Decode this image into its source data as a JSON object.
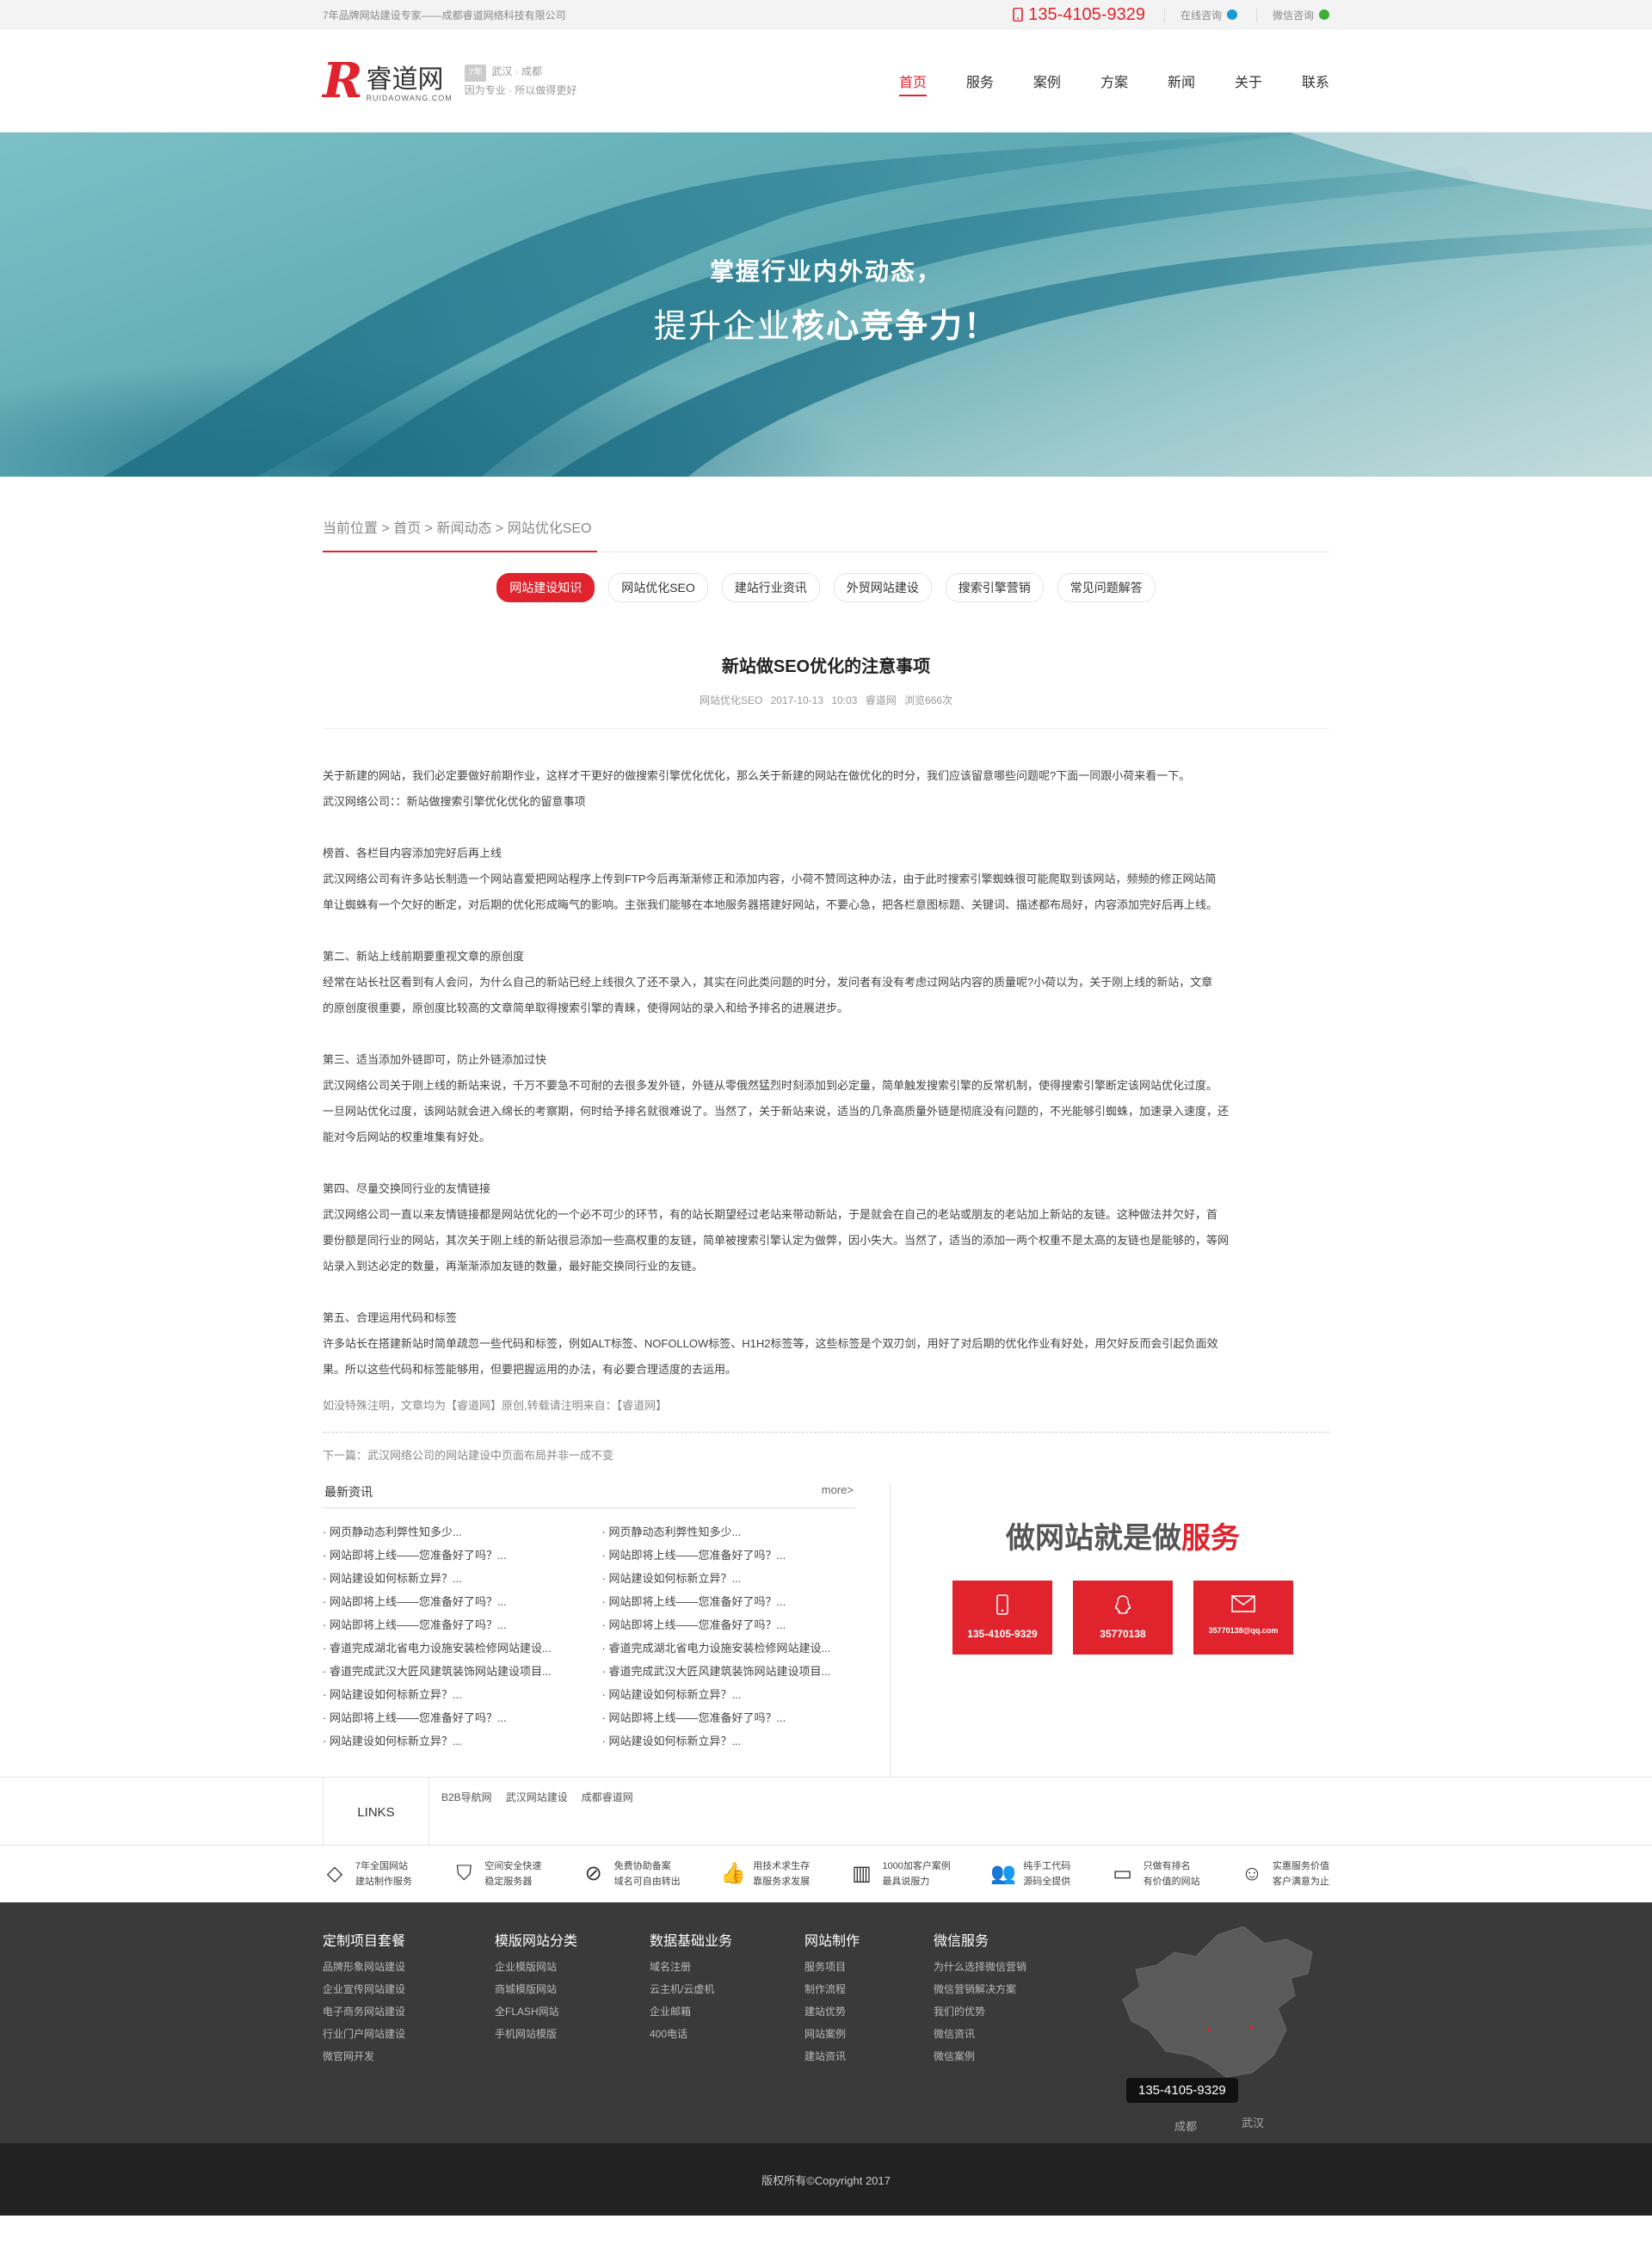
{
  "topbar": {
    "slogan": "7年品牌网站建设专家——成都睿道网络科技有限公司",
    "phone": "135-4105-9329",
    "online": "在线咨询",
    "wechat": "微信咨询"
  },
  "header": {
    "logo_mark": "R",
    "logo_cn": "睿道网",
    "logo_en": "RUIDAOWANG.COM",
    "badge": "7年",
    "cities": "武汉 · 成都",
    "tagline": "因为专业 · 所以做得更好",
    "nav": [
      "首页",
      "服务",
      "案例",
      "方案",
      "新闻",
      "关于",
      "联系"
    ]
  },
  "banner": {
    "line1": "掌握行业内外动态，",
    "line2_a": "提升企业",
    "line2_b": "核心竞争力！"
  },
  "breadcrumb": "当前位置 > 首页 > 新闻动态 > 网站优化SEO",
  "tabs": [
    "网站建设知识",
    "网站优化SEO",
    "建站行业资讯",
    "外贸网站建设",
    "搜索引擎营销",
    "常见问题解答"
  ],
  "article": {
    "title": "新站做SEO优化的注意事项",
    "meta": "网站优化SEO 2017-10-13 10:03 睿道网 浏览666次",
    "paragraphs": [
      "关于新建的网站，我们必定要做好前期作业，这样才干更好的做搜索引擎优化优化，那么关于新建的网站在做优化的时分，我们应该留意哪些问题呢?下面一同跟小荷来看一下。",
      "武汉网络公司：：新站做搜索引擎优化优化的留意事项",
      "",
      "榜首、各栏目内容添加完好后再上线",
      "武汉网络公司有许多站长制造一个网站喜爱把网站程序上传到FTP今后再渐渐修正和添加内容，小荷不赞同这种办法，由于此时搜索引擎蜘蛛很可能爬取到该网站，频频的修正网站简",
      "单让蜘蛛有一个欠好的断定，对后期的优化形成晦气的影响。主张我们能够在本地服务器搭建好网站，不要心急，把各栏意图标题、关键词、描述都布局好，内容添加完好后再上线。",
      "",
      "第二、新站上线前期要重视文章的原创度",
      "经常在站长社区看到有人会问，为什么自己的新站已经上线很久了还不录入，其实在问此类问题的时分，发问者有没有考虑过网站内容的质量呢?小荷以为，关于刚上线的新站，文章",
      "的原创度很重要，原创度比较高的文章简单取得搜索引擎的青睐，使得网站的录入和给予排名的进展进步。",
      "",
      "第三、适当添加外链即可，防止外链添加过快",
      "武汉网络公司关于刚上线的新站来说，千万不要急不可耐的去很多发外链，外链从零俄然猛烈时刻添加到必定量，简单触发搜索引擎的反常机制，使得搜索引擎断定该网站优化过度。",
      "一旦网站优化过度，该网站就会进入绵长的考察期，何时给予排名就很难说了。当然了，关于新站来说，适当的几条高质量外链是彻底没有问题的，不光能够引蜘蛛，加速录入速度，还",
      "能对今后网站的权重堆集有好处。",
      "",
      "第四、尽量交换同行业的友情链接",
      "武汉网络公司一直以来友情链接都是网站优化的一个必不可少的环节，有的站长期望经过老站来带动新站，于是就会在自己的老站或朋友的老站加上新站的友链。这种做法并欠好，首",
      "要份额是同行业的网站，其次关于刚上线的新站很忌添加一些高权重的友链，简单被搜索引擎认定为做弊，因小失大。当然了，适当的添加一两个权重不是太高的友链也是能够的，等网",
      "站录入到达必定的数量，再渐渐添加友链的数量，最好能交换同行业的友链。",
      "",
      "第五、合理运用代码和标签",
      "许多站长在搭建新站时简单疏忽一些代码和标签，例如ALT标签、NOFOLLOW标签、H1H2标签等，这些标签是个双刃剑，用好了对后期的优化作业有好处，用欠好反而会引起负面效",
      "果。所以这些代码和标签能够用，但要把握运用的办法，有必要合理适度的去运用。"
    ],
    "note": "如没特殊注明，文章均为【睿道网】原创,转载请注明来自：【睿道网】",
    "next": "下一篇：武汉网络公司的网站建设中页面布局并非一成不变"
  },
  "news": {
    "heading": "最新资讯",
    "more": "more>",
    "col1": [
      "· 网页静动态利弊性知多少...",
      "· 网站即将上线——您准备好了吗？...",
      "· 网站建设如何标新立异？...",
      "· 网站即将上线——您准备好了吗？...",
      "· 网站即将上线——您准备好了吗？...",
      "· 睿道完成湖北省电力设施安装检修网站建设...",
      "· 睿道完成武汉大匠风建筑装饰网站建设项目...",
      "· 网站建设如何标新立异？...",
      "· 网站即将上线——您准备好了吗？...",
      "· 网站建设如何标新立异？..."
    ],
    "col2": [
      "· 网页静动态利弊性知多少...",
      "· 网站即将上线——您准备好了吗？...",
      "· 网站建设如何标新立异？...",
      "· 网站即将上线——您准备好了吗？...",
      "· 网站即将上线——您准备好了吗？...",
      "· 睿道完成湖北省电力设施安装检修网站建设...",
      "· 睿道完成武汉大匠风建筑装饰网站建设项目...",
      "· 网站建设如何标新立异？...",
      "· 网站即将上线——您准备好了吗？...",
      "· 网站建设如何标新立异？..."
    ]
  },
  "contact": {
    "slogan_a": "做网站就是做",
    "slogan_b": "服务",
    "phone": "135-4105-9329",
    "qq": "35770138",
    "email": "35770138@qq.com"
  },
  "links": {
    "label": "LINKS",
    "items": [
      "B2B导航网",
      "武汉网站建设",
      "成都睿道网"
    ]
  },
  "features": [
    {
      "icon": "diamond-icon",
      "glyph": "◇",
      "l1": "7年全国网站",
      "l2": "建站制作服务"
    },
    {
      "icon": "shield-icon",
      "glyph": "⛉",
      "l1": "空间安全快速",
      "l2": "稳定服务器"
    },
    {
      "icon": "ban-icon",
      "glyph": "⊘",
      "l1": "免费协助备案",
      "l2": "域名可自由转出"
    },
    {
      "icon": "thumb-up-icon",
      "glyph": "👍",
      "l1": "用技术求生存",
      "l2": "靠服务求发展"
    },
    {
      "icon": "books-icon",
      "glyph": "▥",
      "l1": "1000加客户案例",
      "l2": "最具说服力"
    },
    {
      "icon": "users-icon",
      "glyph": "👥",
      "l1": "纯手工代码",
      "l2": "源码全提供"
    },
    {
      "icon": "monitor-icon",
      "glyph": "▭",
      "l1": "只做有排名",
      "l2": "有价值的网站"
    },
    {
      "icon": "smile-icon",
      "glyph": "☺",
      "l1": "实惠服务价值",
      "l2": "客户满意为止"
    }
  ],
  "footer": {
    "cols": [
      {
        "title": "定制项目套餐",
        "items": [
          "品牌形象网站建设",
          "企业宣传网站建设",
          "电子商务网站建设",
          "行业门户网站建设",
          "微官网开发"
        ]
      },
      {
        "title": "模版网站分类",
        "items": [
          "企业模版网站",
          "商城模版网站",
          "全FLASH网站",
          "手机网站模版"
        ]
      },
      {
        "title": "数据基础业务",
        "items": [
          "域名注册",
          "云主机/云虚机",
          "企业邮箱",
          "400电话"
        ]
      },
      {
        "title": "网站制作",
        "items": [
          "服务项目",
          "制作流程",
          "建站优势",
          "网站案例",
          "建站资讯"
        ]
      },
      {
        "title": "微信服务",
        "items": [
          "为什么选择微信营销",
          "微信营销解决方案",
          "我们的优势",
          "微信资讯",
          "微信案例"
        ]
      }
    ],
    "phone": "135-4105-9329",
    "city1": "成都",
    "city2": "武汉",
    "copyright": "版权所有©Copyright 2017"
  },
  "colors": {
    "accent": "#e0232d",
    "footer_bg": "#3a3a3b",
    "copyright_bg": "#222222"
  }
}
